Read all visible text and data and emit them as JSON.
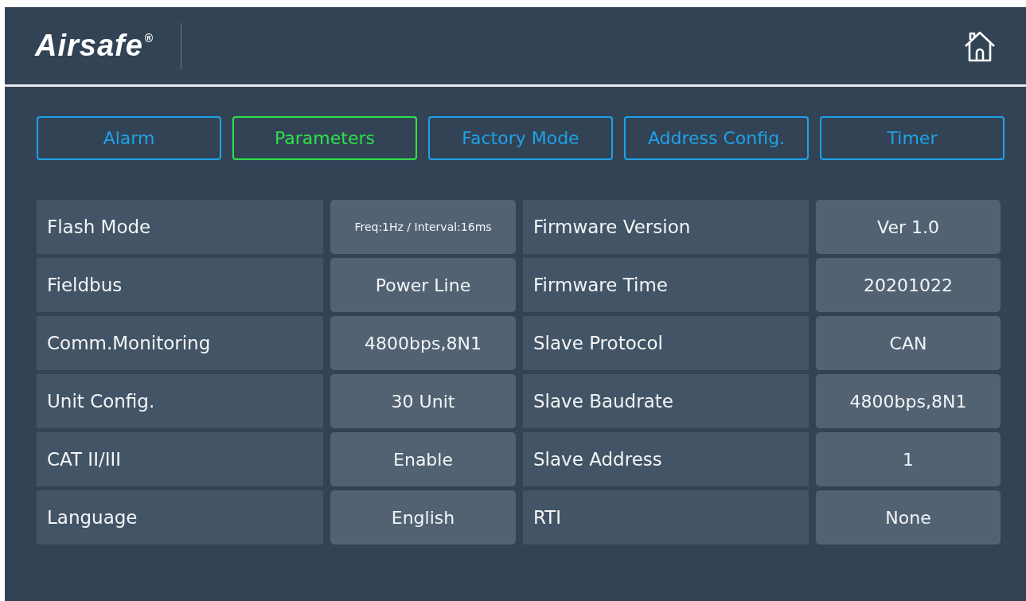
{
  "header": {
    "logo": "Airsafe",
    "logo_mark": "®"
  },
  "tabs": [
    {
      "label": "Alarm",
      "selected": false
    },
    {
      "label": "Parameters",
      "selected": true
    },
    {
      "label": "Factory Mode",
      "selected": false
    },
    {
      "label": "Address Config.",
      "selected": false
    },
    {
      "label": "Timer",
      "selected": false
    }
  ],
  "rows": [
    {
      "left_label": "Flash Mode",
      "left_value": "Freq:1Hz / Interval:16ms",
      "right_label": "Firmware Version",
      "right_value": "Ver  1.0"
    },
    {
      "left_label": "Fieldbus",
      "left_value": "Power Line",
      "right_label": "Firmware Time",
      "right_value": "20201022"
    },
    {
      "left_label": "Comm.Monitoring",
      "left_value": "4800bps,8N1",
      "right_label": "Slave Protocol",
      "right_value": "CAN"
    },
    {
      "left_label": "Unit Config.",
      "left_value": "30  Unit",
      "right_label": "Slave Baudrate",
      "right_value": "4800bps,8N1"
    },
    {
      "left_label": "CAT II/III",
      "left_value": "Enable",
      "right_label": "Slave Address",
      "right_value": "1"
    },
    {
      "left_label": "Language",
      "left_value": "English",
      "right_label": "RTI",
      "right_value": "None"
    }
  ]
}
